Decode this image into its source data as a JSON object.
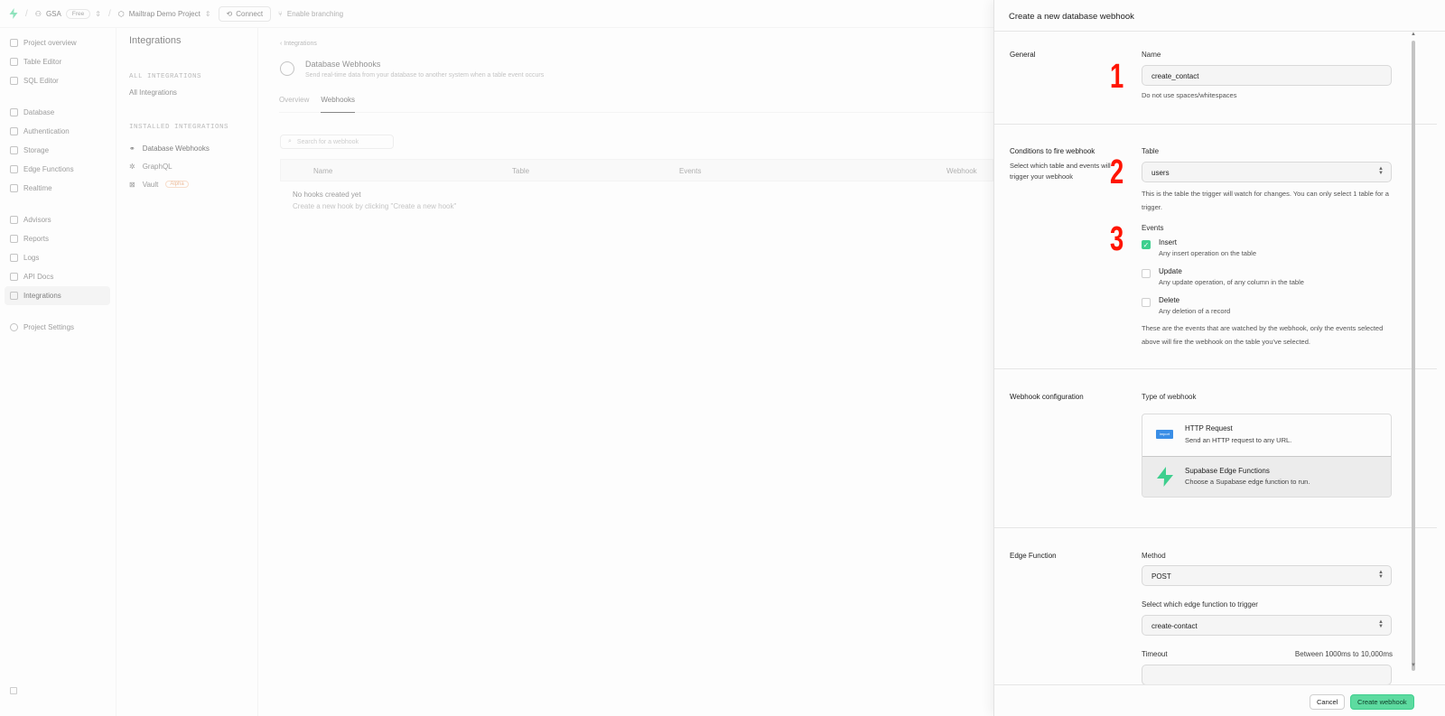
{
  "topbar": {
    "org": "GSA",
    "plan": "Free",
    "project": "Mailtrap Demo Project",
    "connect": "Connect",
    "branching": "Enable branching"
  },
  "sidebar": {
    "items": [
      {
        "label": "Project overview",
        "icon": "home-icon"
      },
      {
        "label": "Table Editor",
        "icon": "table-icon"
      },
      {
        "label": "SQL Editor",
        "icon": "terminal-icon"
      },
      {
        "label": "Database",
        "icon": "database-icon"
      },
      {
        "label": "Authentication",
        "icon": "users-icon"
      },
      {
        "label": "Storage",
        "icon": "archive-icon"
      },
      {
        "label": "Edge Functions",
        "icon": "code-icon"
      },
      {
        "label": "Realtime",
        "icon": "realtime-icon"
      },
      {
        "label": "Advisors",
        "icon": "lightbulb-icon"
      },
      {
        "label": "Reports",
        "icon": "chart-icon"
      },
      {
        "label": "Logs",
        "icon": "list-icon"
      },
      {
        "label": "API Docs",
        "icon": "file-icon"
      },
      {
        "label": "Integrations",
        "icon": "grid-icon"
      },
      {
        "label": "Project Settings",
        "icon": "gear-icon"
      }
    ]
  },
  "subnav": {
    "title": "Integrations",
    "all_section": "ALL INTEGRATIONS",
    "all_link": "All Integrations",
    "installed_section": "INSTALLED INTEGRATIONS",
    "installed": [
      "Database Webhooks",
      "GraphQL",
      "Vault"
    ],
    "vault_badge": "Alpha"
  },
  "main": {
    "back": "Integrations",
    "title": "Database Webhooks",
    "subtitle": "Send real-time data from your database to another system when a table event occurs",
    "tabs": [
      "Overview",
      "Webhooks"
    ],
    "search_placeholder": "Search for a webhook",
    "columns": [
      "Name",
      "Table",
      "Events",
      "Webhook"
    ],
    "empty_title": "No hooks created yet",
    "empty_sub": "Create a new hook by clicking \"Create a new hook\""
  },
  "panel": {
    "title": "Create a new database webhook",
    "general": {
      "label": "General",
      "name_label": "Name",
      "name_value": "create_contact",
      "name_help": "Do not use spaces/whitespaces"
    },
    "conditions": {
      "label": "Conditions to fire webhook",
      "desc": "Select which table and events will trigger your webhook",
      "table_label": "Table",
      "table_value": "users",
      "table_help": "This is the table the trigger will watch for changes. You can only select 1 table for a trigger.",
      "events_label": "Events",
      "events": [
        {
          "title": "Insert",
          "desc": "Any insert operation on the table",
          "checked": true
        },
        {
          "title": "Update",
          "desc": "Any update operation, of any column in the table",
          "checked": false
        },
        {
          "title": "Delete",
          "desc": "Any deletion of a record",
          "checked": false
        }
      ],
      "events_help": "These are the events that are watched by the webhook, only the events selected above will fire the webhook on the table you've selected."
    },
    "config": {
      "label": "Webhook configuration",
      "type_label": "Type of webhook",
      "options": [
        {
          "title": "HTTP Request",
          "desc": "Send an HTTP request to any URL.",
          "icon": "http-request-icon",
          "icon_text": "import"
        },
        {
          "title": "Supabase Edge Functions",
          "desc": "Choose a Supabase edge function to run.",
          "icon": "supabase-bolt-icon"
        }
      ]
    },
    "edge": {
      "label": "Edge Function",
      "method_label": "Method",
      "method_value": "POST",
      "function_label": "Select which edge function to trigger",
      "function_value": "create-contact",
      "timeout_label": "Timeout",
      "timeout_hint": "Between 1000ms to 10,000ms"
    },
    "annotations": [
      "1",
      "2",
      "3"
    ],
    "cancel": "Cancel",
    "create": "Create webhook"
  },
  "colors": {
    "brand": "#3ecf8e",
    "annotation": "#ff1400",
    "http_icon": "#3a8ee6"
  }
}
